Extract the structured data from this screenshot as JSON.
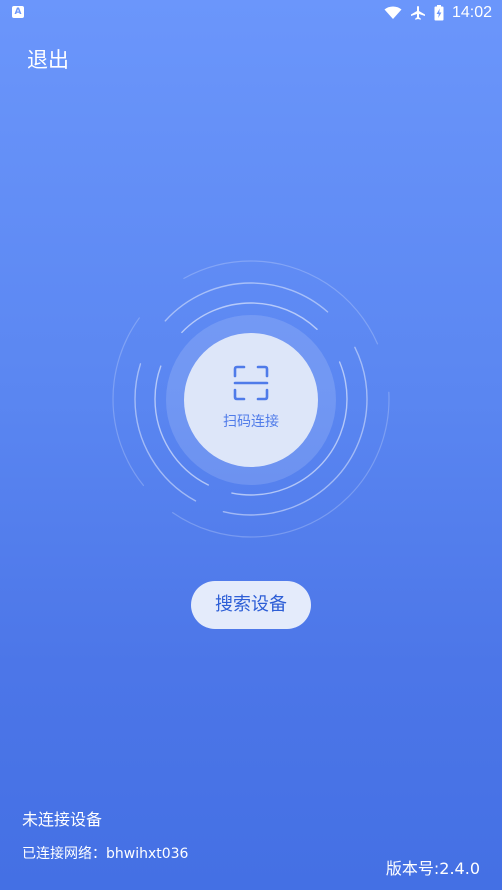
{
  "status_bar": {
    "time": "14:02",
    "left_icon": "A",
    "icons": [
      "wifi-icon",
      "airplane-icon",
      "battery-charging-icon"
    ]
  },
  "header": {
    "exit_label": "退出"
  },
  "scan": {
    "label": "扫码连接",
    "icon": "scan-frame-icon"
  },
  "search": {
    "label": "搜索设备"
  },
  "footer": {
    "status": "未连接设备",
    "network": "已连接网络：bhwihxt036",
    "version": "版本号:2.4.0"
  },
  "colors": {
    "background_top": "#6b96fb",
    "background_bottom": "#4470e4",
    "accent": "#4f7be9",
    "button_bg": "#e4ebfb"
  }
}
